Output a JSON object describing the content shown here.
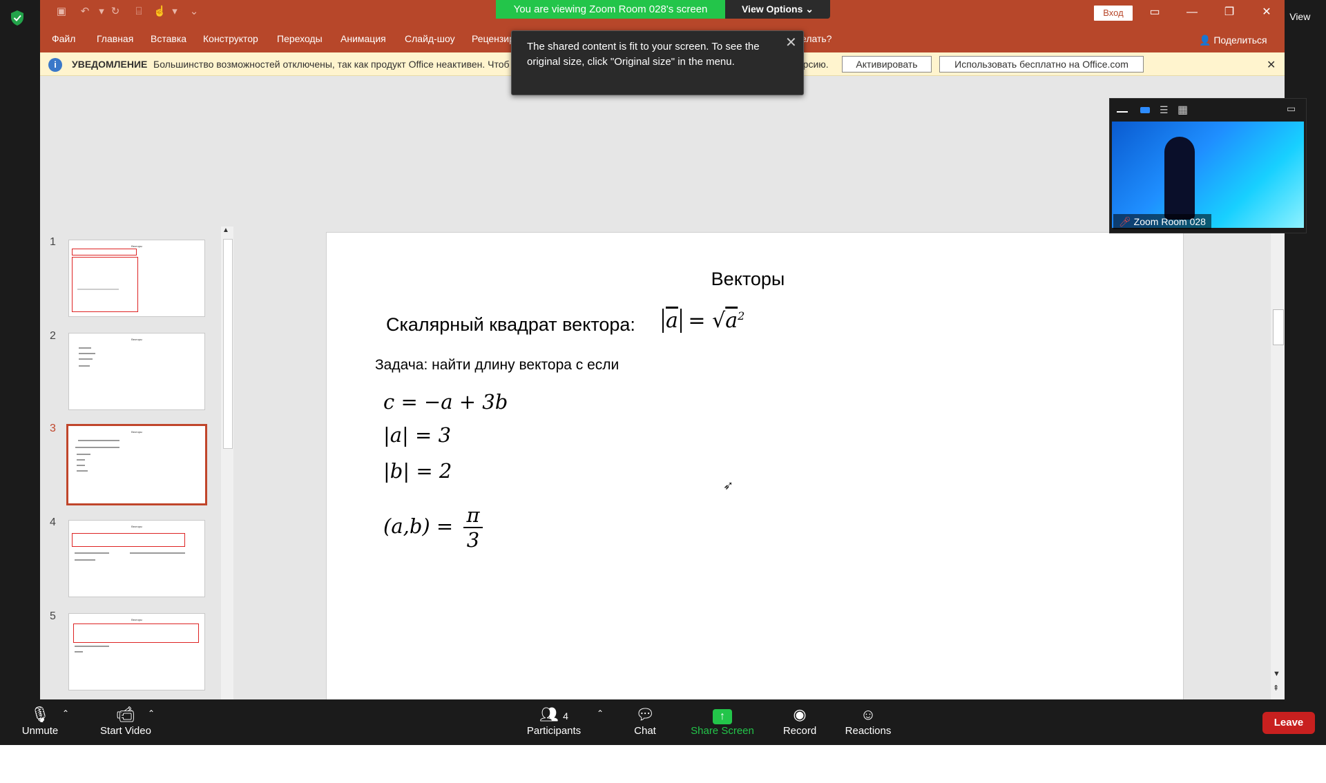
{
  "zoom": {
    "viewing_banner": "You are viewing Zoom Room 028's screen",
    "view_options": "View Options",
    "view_btn": "View",
    "tooltip": "The shared content is fit to your screen. To see the original size, click \"Original size\" in the menu.",
    "video_label": "Zoom Room 028",
    "toolbar": {
      "unmute": "Unmute",
      "start_video": "Start Video",
      "participants": "Participants",
      "participants_count": "4",
      "chat": "Chat",
      "share_screen": "Share Screen",
      "record": "Record",
      "reactions": "Reactions",
      "leave": "Leave"
    }
  },
  "ppt": {
    "login": "Вход",
    "share": "Поделиться",
    "menu": [
      "Файл",
      "Главная",
      "Вставка",
      "Конструктор",
      "Переходы",
      "Анимация",
      "Слайд-шоу",
      "Рецензир",
      "елать?"
    ],
    "notification": {
      "title": "УВЕДОМЛЕНИЕ",
      "text": "Большинство возможностей отключены, так как продукт Office неактивен. Чтоб",
      "text_tail": "веб-версию.",
      "activate": "Активировать",
      "use_free": "Использовать бесплатно на Office.com"
    },
    "slide_numbers": [
      "1",
      "2",
      "3",
      "4",
      "5"
    ],
    "slide": {
      "title": "Векторы",
      "heading": "Скалярный квадрат вектора:",
      "task": "Задача: найти длину вектора с если",
      "formula_sq": "|a| = √a²",
      "eq1": "c = −a + 3b",
      "eq2": "|a| = 3",
      "eq3": "|b| = 2",
      "eq4_lhs": "(a,b) =",
      "eq4_num": "π",
      "eq4_den": "3"
    }
  },
  "colors": {
    "ppt_red": "#b7472a",
    "zoom_green": "#23c54a",
    "zoom_dark": "#1b1b1b",
    "leave_red": "#c8201f",
    "notify_bg": "#fff4ce"
  }
}
